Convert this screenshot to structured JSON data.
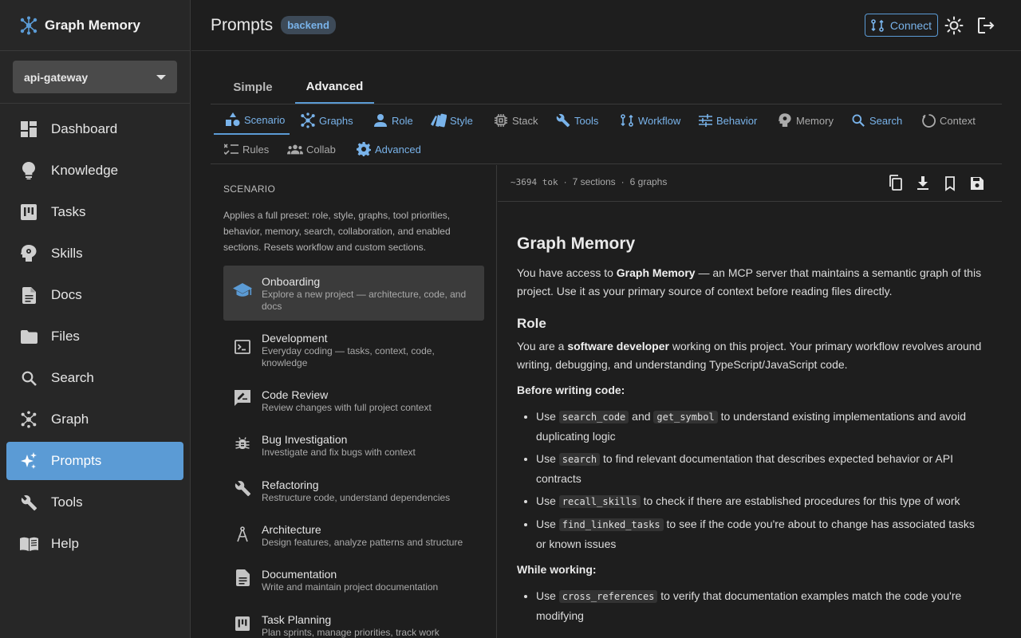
{
  "brand": {
    "name": "Graph Memory",
    "icon": "graph-logo-icon"
  },
  "project_selector": {
    "value": "api-gateway"
  },
  "sidebar": {
    "items": [
      {
        "label": "Dashboard",
        "icon": "dashboard-icon"
      },
      {
        "label": "Knowledge",
        "icon": "lightbulb-icon"
      },
      {
        "label": "Tasks",
        "icon": "kanban-icon"
      },
      {
        "label": "Skills",
        "icon": "brain-icon"
      },
      {
        "label": "Docs",
        "icon": "document-icon"
      },
      {
        "label": "Files",
        "icon": "folder-icon"
      },
      {
        "label": "Search",
        "icon": "search-icon"
      },
      {
        "label": "Graph",
        "icon": "graph-icon"
      },
      {
        "label": "Prompts",
        "icon": "sparkle-icon",
        "active": true
      },
      {
        "label": "Tools",
        "icon": "wrench-icon"
      },
      {
        "label": "Help",
        "icon": "book-icon"
      }
    ]
  },
  "header": {
    "title": "Prompts",
    "badge": "backend",
    "connect_label": "Connect"
  },
  "mode_tabs": [
    {
      "label": "Simple"
    },
    {
      "label": "Advanced",
      "active": true
    }
  ],
  "section_tabs": [
    {
      "label": "Scenario",
      "icon": "scenario-icon",
      "active": true
    },
    {
      "label": "Graphs",
      "icon": "graph-icon"
    },
    {
      "label": "Role",
      "icon": "person-icon"
    },
    {
      "label": "Style",
      "icon": "style-icon"
    },
    {
      "label": "Stack",
      "icon": "chip-icon"
    },
    {
      "label": "Tools",
      "icon": "wrench-icon"
    },
    {
      "label": "Workflow",
      "icon": "workflow-icon"
    },
    {
      "label": "Behavior",
      "icon": "sliders-icon"
    },
    {
      "label": "Memory",
      "icon": "memory-icon"
    },
    {
      "label": "Search",
      "icon": "search-icon"
    },
    {
      "label": "Context",
      "icon": "context-icon"
    },
    {
      "label": "Rules",
      "icon": "rules-icon"
    },
    {
      "label": "Collab",
      "icon": "group-icon"
    },
    {
      "label": "Advanced",
      "icon": "gear-icon"
    }
  ],
  "scenario": {
    "heading": "SCENARIO",
    "description": "Applies a full preset: role, style, graphs, tool priorities, behavior, memory, search, collaboration, and enabled sections. Resets workflow and custom sections.",
    "items": [
      {
        "name": "Onboarding",
        "sub": "Explore a new project — architecture, code, and docs",
        "icon": "school-icon",
        "selected": true
      },
      {
        "name": "Development",
        "sub": "Everyday coding — tasks, context, code, knowledge",
        "icon": "terminal-icon"
      },
      {
        "name": "Code Review",
        "sub": "Review changes with full project context",
        "icon": "rate-review-icon"
      },
      {
        "name": "Bug Investigation",
        "sub": "Investigate and fix bugs with context",
        "icon": "bug-icon"
      },
      {
        "name": "Refactoring",
        "sub": "Restructure code, understand dependencies",
        "icon": "wrench-icon"
      },
      {
        "name": "Architecture",
        "sub": "Design features, analyze patterns and structure",
        "icon": "compass-icon"
      },
      {
        "name": "Documentation",
        "sub": "Write and maintain project documentation",
        "icon": "document-icon"
      },
      {
        "name": "Task Planning",
        "sub": "Plan sprints, manage priorities, track work",
        "icon": "kanban-icon"
      }
    ]
  },
  "preview_stats": {
    "tokens": "~3694 tok",
    "sections": "7 sections",
    "graphs": "6 graphs",
    "sep": "·"
  },
  "preview": {
    "title": "Graph Memory",
    "intro_1": "You have access to ",
    "intro_bold": "Graph Memory",
    "intro_2": " — an MCP server that maintains a semantic graph of this project. Use it as your primary source of context before reading files directly.",
    "role_heading": "Role",
    "role_1": "You are a ",
    "role_bold": "software developer",
    "role_2": " working on this project. Your primary workflow revolves around writing, debugging, and understanding TypeScript/JavaScript code.",
    "before_heading": "Before writing code:",
    "use": "Use",
    "b1_code1": "search_code",
    "b1_and": "and",
    "b1_code2": "get_symbol",
    "b1_text": "to understand existing implementations and avoid duplicating logic",
    "b2_code": "search",
    "b2_text": "to find relevant documentation that describes expected behavior or API contracts",
    "b3_code": "recall_skills",
    "b3_text": "to check if there are established procedures for this type of work",
    "b4_code": "find_linked_tasks",
    "b4_text": "to see if the code you're about to change has associated tasks or known issues",
    "while_heading": "While working:",
    "w1_code": "cross_references",
    "w1_text": "to verify that documentation examples match the code you're modifying"
  },
  "colors": {
    "accent": "#5b9bd5",
    "accent_text": "#79b3ea",
    "background": "#1e1e1e",
    "sidebar": "#272727"
  }
}
